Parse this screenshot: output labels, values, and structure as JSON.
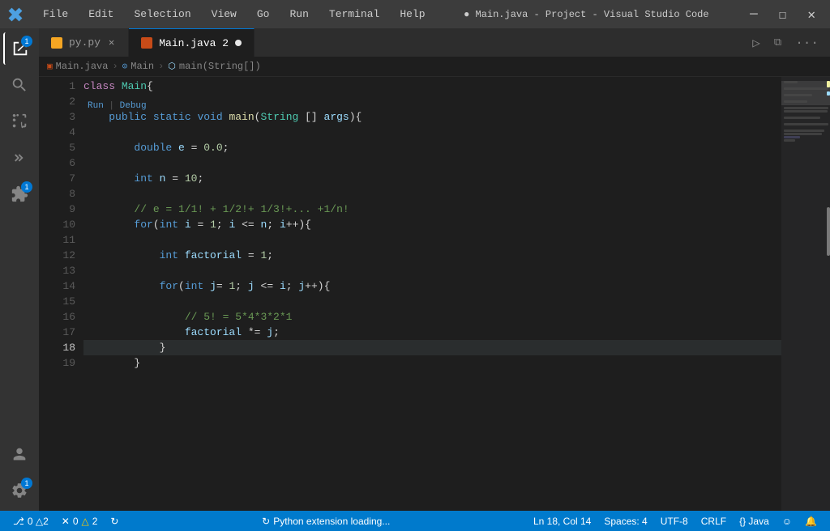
{
  "titlebar": {
    "menus": [
      "File",
      "Edit",
      "Selection",
      "View",
      "Go",
      "Run",
      "Terminal",
      "Help"
    ],
    "title": "● Main.java - Project - Visual Studio Code",
    "controls": [
      "─",
      "☐",
      "✕"
    ]
  },
  "tabs": [
    {
      "id": "py",
      "label": "py.py",
      "icon_color": "#f5a623",
      "active": false,
      "modified": false
    },
    {
      "id": "main_java",
      "label": "Main.java",
      "num": "2",
      "icon_color": "#c74b18",
      "active": true,
      "modified": true
    }
  ],
  "breadcrumb": [
    {
      "label": "Main.java",
      "icon": "file"
    },
    {
      "label": "Main",
      "icon": "class"
    },
    {
      "label": "main(String[])",
      "icon": "method"
    }
  ],
  "code": {
    "lines": [
      {
        "num": 1,
        "tokens": [
          {
            "t": "kw2",
            "v": "class "
          },
          {
            "t": "type",
            "v": "Main"
          },
          {
            "t": "plain",
            "v": "{"
          }
        ]
      },
      {
        "num": 2,
        "tokens": []
      },
      {
        "num": 3,
        "tokens": [
          {
            "t": "plain",
            "v": "    "
          },
          {
            "t": "kw",
            "v": "public "
          },
          {
            "t": "kw",
            "v": "static "
          },
          {
            "t": "kw",
            "v": "void "
          },
          {
            "t": "fn",
            "v": "main"
          },
          {
            "t": "plain",
            "v": "("
          },
          {
            "t": "type",
            "v": "String"
          },
          {
            "t": "plain",
            "v": " [] "
          },
          {
            "t": "var",
            "v": "args"
          },
          {
            "t": "plain",
            "v": "){"
          }
        ]
      },
      {
        "num": 4,
        "tokens": []
      },
      {
        "num": 5,
        "tokens": [
          {
            "t": "plain",
            "v": "        "
          },
          {
            "t": "kw",
            "v": "double "
          },
          {
            "t": "var",
            "v": "e"
          },
          {
            "t": "plain",
            "v": " = "
          },
          {
            "t": "num",
            "v": "0.0"
          },
          {
            "t": "plain",
            "v": ";"
          }
        ]
      },
      {
        "num": 6,
        "tokens": []
      },
      {
        "num": 7,
        "tokens": [
          {
            "t": "plain",
            "v": "        "
          },
          {
            "t": "kw",
            "v": "int "
          },
          {
            "t": "var",
            "v": "n"
          },
          {
            "t": "plain",
            "v": " = "
          },
          {
            "t": "num",
            "v": "10"
          },
          {
            "t": "plain",
            "v": ";"
          }
        ]
      },
      {
        "num": 8,
        "tokens": []
      },
      {
        "num": 9,
        "tokens": [
          {
            "t": "plain",
            "v": "        "
          },
          {
            "t": "comment",
            "v": "// e = 1/1! + 1/2!+ 1/3!+... +1/n!"
          }
        ]
      },
      {
        "num": 10,
        "tokens": [
          {
            "t": "plain",
            "v": "        "
          },
          {
            "t": "kw",
            "v": "for"
          },
          {
            "t": "plain",
            "v": "("
          },
          {
            "t": "kw",
            "v": "int "
          },
          {
            "t": "var",
            "v": "i"
          },
          {
            "t": "plain",
            "v": " = "
          },
          {
            "t": "num",
            "v": "1"
          },
          {
            "t": "plain",
            "v": "; "
          },
          {
            "t": "var",
            "v": "i"
          },
          {
            "t": "plain",
            "v": " <= "
          },
          {
            "t": "var",
            "v": "n"
          },
          {
            "t": "plain",
            "v": "; "
          },
          {
            "t": "var",
            "v": "i"
          },
          {
            "t": "plain",
            "v": "++){"
          }
        ]
      },
      {
        "num": 11,
        "tokens": []
      },
      {
        "num": 12,
        "tokens": [
          {
            "t": "plain",
            "v": "            "
          },
          {
            "t": "kw",
            "v": "int "
          },
          {
            "t": "var",
            "v": "factorial"
          },
          {
            "t": "plain",
            "v": " = "
          },
          {
            "t": "num",
            "v": "1"
          },
          {
            "t": "plain",
            "v": ";"
          }
        ]
      },
      {
        "num": 13,
        "tokens": []
      },
      {
        "num": 14,
        "tokens": [
          {
            "t": "plain",
            "v": "            "
          },
          {
            "t": "kw",
            "v": "for"
          },
          {
            "t": "plain",
            "v": "("
          },
          {
            "t": "kw",
            "v": "int "
          },
          {
            "t": "var",
            "v": "j"
          },
          {
            "t": "plain",
            "v": "= "
          },
          {
            "t": "num",
            "v": "1"
          },
          {
            "t": "plain",
            "v": "; "
          },
          {
            "t": "var",
            "v": "j"
          },
          {
            "t": "plain",
            "v": " <= "
          },
          {
            "t": "var",
            "v": "i"
          },
          {
            "t": "plain",
            "v": "; "
          },
          {
            "t": "var",
            "v": "j"
          },
          {
            "t": "plain",
            "v": "++){"
          }
        ]
      },
      {
        "num": 15,
        "tokens": []
      },
      {
        "num": 16,
        "tokens": [
          {
            "t": "plain",
            "v": "                "
          },
          {
            "t": "comment",
            "v": "// 5! = 5*4*3*2*1"
          }
        ]
      },
      {
        "num": 17,
        "tokens": [
          {
            "t": "plain",
            "v": "                "
          },
          {
            "t": "var",
            "v": "factorial"
          },
          {
            "t": "plain",
            "v": " *= "
          },
          {
            "t": "var",
            "v": "j"
          },
          {
            "t": "plain",
            "v": ";"
          }
        ]
      },
      {
        "num": 18,
        "tokens": [
          {
            "t": "plain",
            "v": "            "
          },
          {
            "t": "plain",
            "v": "}"
          }
        ],
        "highlight": true
      },
      {
        "num": 19,
        "tokens": [
          {
            "t": "plain",
            "v": "        "
          },
          {
            "t": "plain",
            "v": "}"
          }
        ]
      }
    ]
  },
  "statusbar": {
    "left": [
      {
        "id": "git",
        "icon": "⎇",
        "label": "0 △2",
        "extra": ""
      },
      {
        "id": "errors",
        "icon": "✕",
        "label": "0",
        "warning_icon": "△",
        "warning_label": "2"
      },
      {
        "id": "sync",
        "icon": "↻",
        "label": ""
      }
    ],
    "center": {
      "label": "Python extension loading..."
    },
    "right": [
      {
        "id": "position",
        "label": "Ln 18, Col 14"
      },
      {
        "id": "spaces",
        "label": "Spaces: 4"
      },
      {
        "id": "encoding",
        "label": "UTF-8"
      },
      {
        "id": "eol",
        "label": "CRLF"
      },
      {
        "id": "lang",
        "label": "{} Java"
      },
      {
        "id": "feedback",
        "icon": "☺",
        "label": ""
      },
      {
        "id": "bell",
        "icon": "🔔",
        "label": ""
      }
    ]
  },
  "run_debug": "Run | Debug",
  "activity": {
    "icons": [
      {
        "id": "explorer",
        "symbol": "⎗",
        "active": true,
        "badge": "1"
      },
      {
        "id": "search",
        "symbol": "🔍",
        "active": false
      },
      {
        "id": "source-control",
        "symbol": "⑂",
        "active": false
      },
      {
        "id": "run",
        "symbol": "▷",
        "active": false
      },
      {
        "id": "extensions",
        "symbol": "⊞",
        "active": false,
        "badge": "1"
      }
    ],
    "bottom": [
      {
        "id": "account",
        "symbol": "👤",
        "active": false
      },
      {
        "id": "settings",
        "symbol": "⚙",
        "active": false,
        "badge": "1"
      }
    ]
  }
}
